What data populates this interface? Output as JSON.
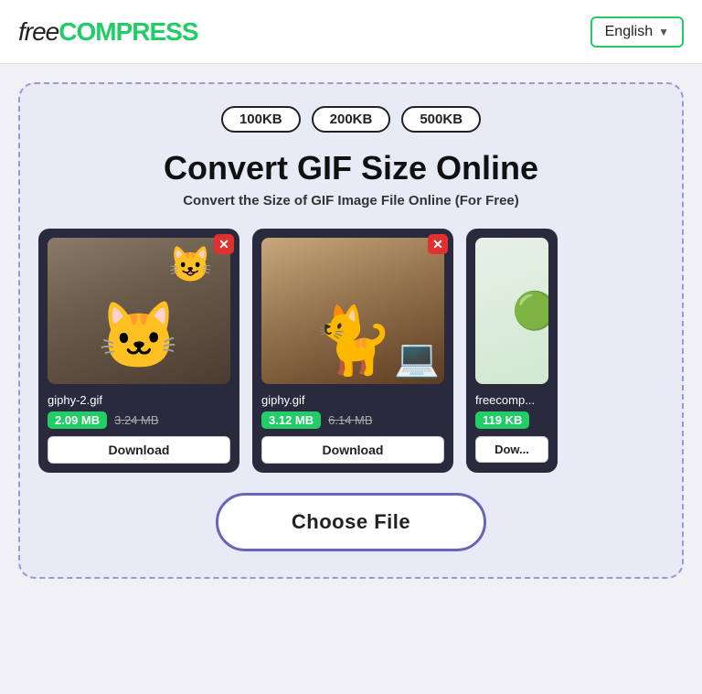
{
  "header": {
    "logo_free": "free",
    "logo_compress": "COMPRESS",
    "lang_label": "English",
    "lang_chevron": "▼"
  },
  "tool": {
    "badges": [
      "100KB",
      "200KB",
      "500KB"
    ],
    "title": "Convert GIF Size Online",
    "subtitle": "Convert the Size of GIF Image File Online (For Free)",
    "files": [
      {
        "name": "giphy-2.gif",
        "size_new": "2.09 MB",
        "size_old": "3.24 MB",
        "download_label": "Download",
        "close_symbol": "✕",
        "type": "cat1"
      },
      {
        "name": "giphy.gif",
        "size_new": "3.12 MB",
        "size_old": "6.14 MB",
        "download_label": "Download",
        "close_symbol": "✕",
        "type": "cat2"
      },
      {
        "name": "freecomp...",
        "size_new": "119 KB",
        "download_label": "Dow...",
        "type": "cat3",
        "partial": true
      }
    ],
    "choose_file_label": "Choose File"
  }
}
